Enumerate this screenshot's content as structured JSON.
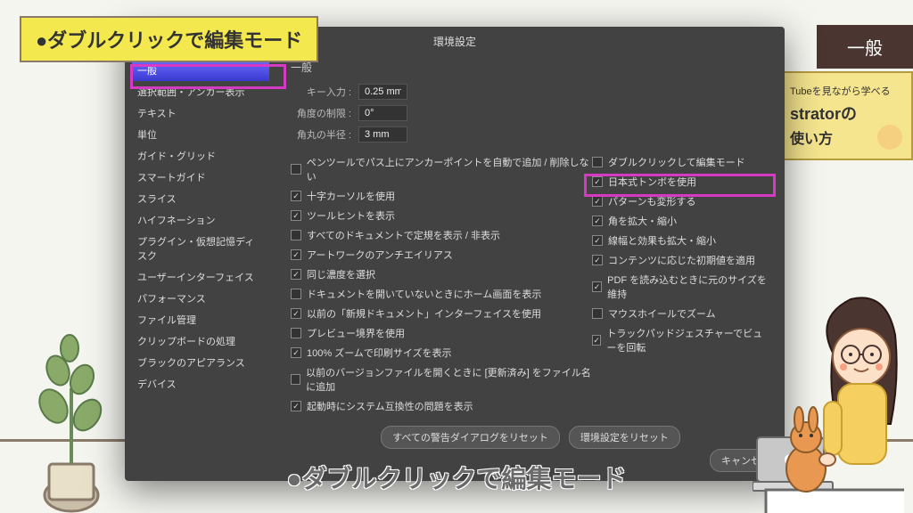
{
  "callout_top": "●ダブルクリックで編集モード",
  "label_topright": "一般",
  "side_panel": {
    "line1": "Tubeを見ながら学べる",
    "line2": "stratorの",
    "line3": "使い方"
  },
  "dialog": {
    "title": "環境設定",
    "content_header": "一般",
    "sidebar": [
      "一般",
      "選択範囲・アンカー表示",
      "テキスト",
      "単位",
      "ガイド・グリッド",
      "スマートガイド",
      "スライス",
      "ハイフネーション",
      "プラグイン・仮想記憶ディスク",
      "ユーザーインターフェイス",
      "パフォーマンス",
      "ファイル管理",
      "クリップボードの処理",
      "ブラックのアピアランス",
      "デバイス"
    ],
    "fields": {
      "key_input_label": "キー入力 :",
      "key_input_value": "0.25 mm",
      "angle_label": "角度の制限 :",
      "angle_value": "0°",
      "corner_label": "角丸の半径 :",
      "corner_value": "3 mm"
    },
    "checkboxes_left": [
      {
        "checked": false,
        "label": "ペンツールでパス上にアンカーポイントを自動で追加 / 削除しない"
      },
      {
        "checked": true,
        "label": "十字カーソルを使用"
      },
      {
        "checked": true,
        "label": "ツールヒントを表示"
      },
      {
        "checked": false,
        "label": "すべてのドキュメントで定規を表示 / 非表示"
      },
      {
        "checked": true,
        "label": "アートワークのアンチエイリアス"
      },
      {
        "checked": true,
        "label": "同じ濃度を選択"
      },
      {
        "checked": false,
        "label": "ドキュメントを開いていないときにホーム画面を表示"
      },
      {
        "checked": true,
        "label": "以前の「新規ドキュメント」インターフェイスを使用"
      },
      {
        "checked": false,
        "label": "プレビュー境界を使用"
      },
      {
        "checked": true,
        "label": "100% ズームで印刷サイズを表示"
      },
      {
        "checked": false,
        "label": "以前のバージョンファイルを開くときに [更新済み] をファイル名に追加"
      },
      {
        "checked": true,
        "label": "起動時にシステム互換性の問題を表示"
      }
    ],
    "checkboxes_right": [
      {
        "checked": false,
        "label": "ダブルクリックして編集モード"
      },
      {
        "checked": true,
        "label": "日本式トンボを使用"
      },
      {
        "checked": true,
        "label": "パターンも変形する"
      },
      {
        "checked": true,
        "label": "角を拡大・縮小"
      },
      {
        "checked": true,
        "label": "線幅と効果も拡大・縮小"
      },
      {
        "checked": true,
        "label": "コンテンツに応じた初期値を適用"
      },
      {
        "checked": true,
        "label": "PDF を読み込むときに元のサイズを維持"
      },
      {
        "checked": false,
        "label": "マウスホイールでズーム"
      },
      {
        "checked": true,
        "label": "トラックパッドジェスチャーでビューを回転"
      }
    ],
    "reset_all_warnings": "すべての警告ダイアログをリセット",
    "reset_prefs": "環境設定をリセット",
    "cancel": "キャンセ"
  },
  "caption_bottom": "●ダブルクリックで編集モード"
}
